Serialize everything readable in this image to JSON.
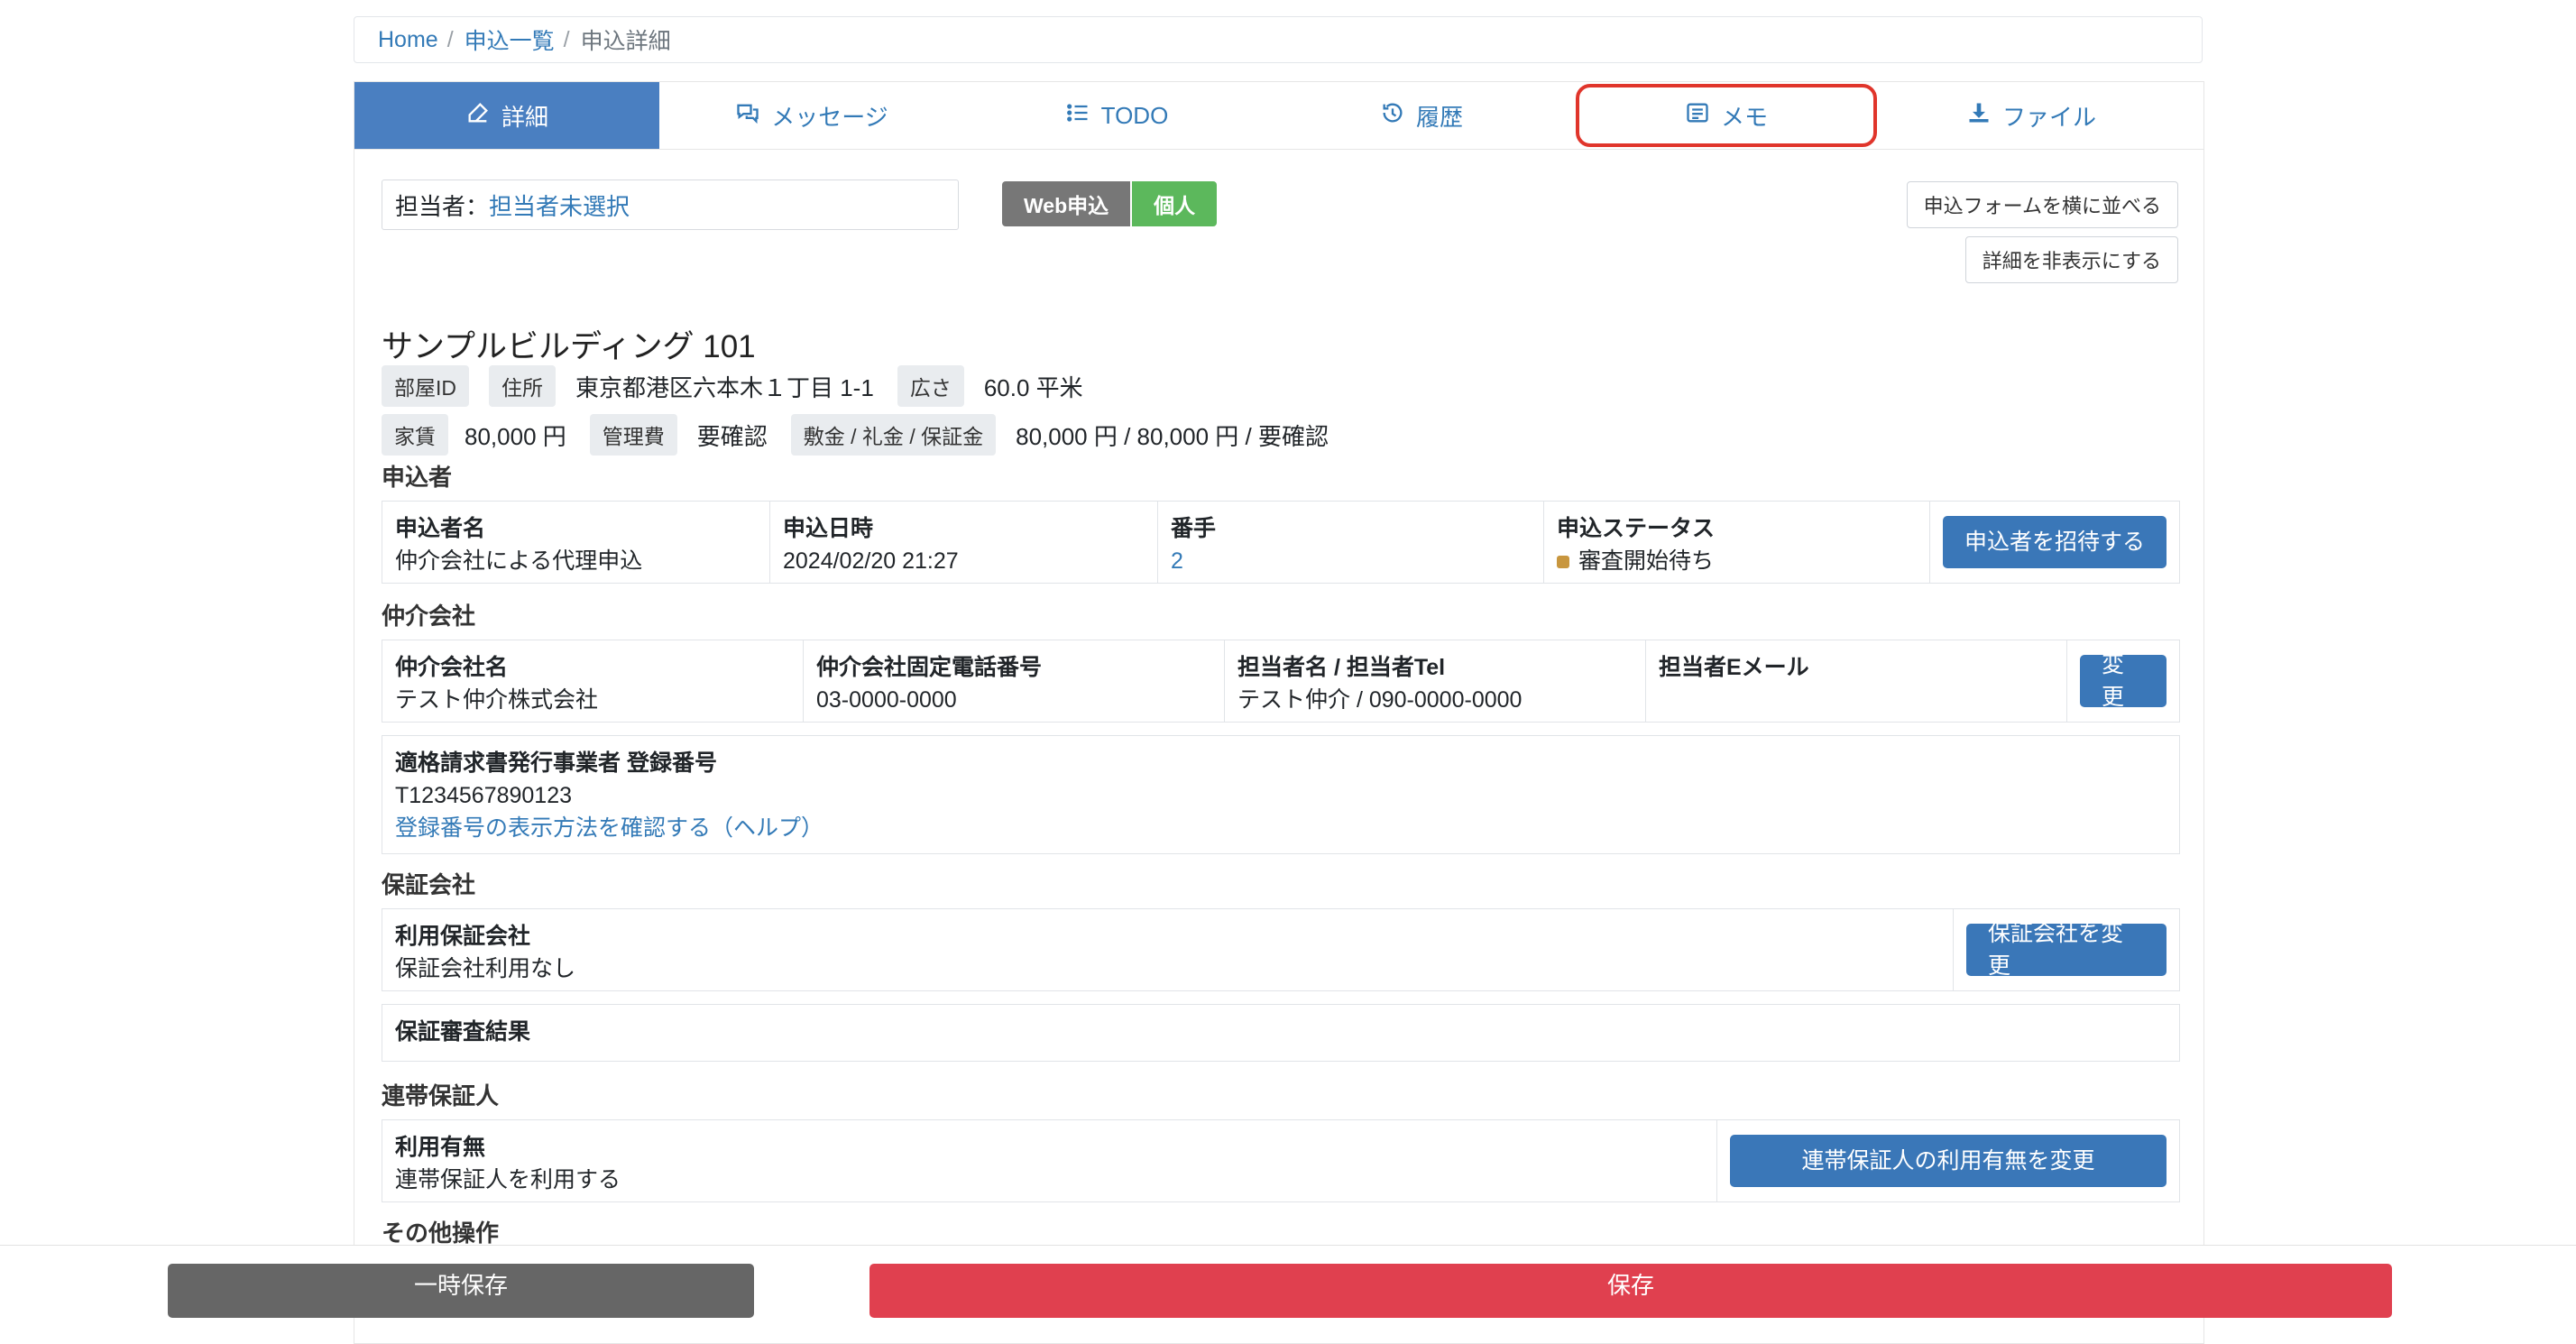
{
  "breadcrumb": {
    "home": "Home",
    "list": "申込一覧",
    "current": "申込詳細"
  },
  "tabs": [
    {
      "label": "詳細",
      "icon": "edit-icon"
    },
    {
      "label": "メッセージ",
      "icon": "comments-icon"
    },
    {
      "label": "TODO",
      "icon": "list-icon"
    },
    {
      "label": "履歴",
      "icon": "history-icon"
    },
    {
      "label": "メモ",
      "icon": "memo-list-icon"
    },
    {
      "label": "ファイル",
      "icon": "download-icon"
    }
  ],
  "assignee": {
    "label": "担当者：",
    "value": "担当者未選択"
  },
  "badges": {
    "type": "Web申込",
    "category": "個人"
  },
  "buttons": {
    "side_by_side": "申込フォームを横に並べる",
    "hide_details": "詳細を非表示にする"
  },
  "property": {
    "name": "サンプルビルディング 101",
    "room_id_tag": "部屋ID",
    "address_tag": "住所",
    "address": "東京都港区六本木１丁目 1-1",
    "area_tag": "広さ",
    "area": "60.0 平米",
    "rent_tag": "家賃",
    "rent": "80,000 円",
    "fee_tag": "管理費",
    "fee": "要確認",
    "deposit_tag": "敷金 / 礼金 / 保証金",
    "deposit": "80,000 円 / 80,000 円 / 要確認"
  },
  "applicant": {
    "section": "申込者",
    "name_h": "申込者名",
    "name": "仲介会社による代理申込",
    "date_h": "申込日時",
    "date": "2024/02/20 21:27",
    "num_h": "番手",
    "num": "2",
    "status_h": "申込ステータス",
    "status": "審査開始待ち",
    "invite_button": "申込者を招待する"
  },
  "broker": {
    "section": "仲介会社",
    "name_h": "仲介会社名",
    "name": "テスト仲介株式会社",
    "phone_h": "仲介会社固定電話番号",
    "phone": "03-0000-0000",
    "contact_h": "担当者名 / 担当者Tel",
    "contact": "テスト仲介 / 090-0000-0000",
    "email_h": "担当者Eメール",
    "email": "",
    "change_button": "変更",
    "invoice_h": "適格請求書発行事業者 登録番号",
    "invoice": "T1234567890123",
    "invoice_help": "登録番号の表示方法を確認する（ヘルプ）"
  },
  "guarantee": {
    "section": "保証会社",
    "company_h": "利用保証会社",
    "company": "保証会社利用なし",
    "change_button": "保証会社を変更",
    "result_h": "保証審査結果"
  },
  "joint": {
    "section": "連帯保証人",
    "use_h": "利用有無",
    "use": "連帯保証人を利用する",
    "change_button": "連帯保証人の利用有無を変更"
  },
  "other": {
    "section": "その他操作"
  },
  "footer": {
    "temp_save": "一時保存",
    "save": "保存"
  }
}
